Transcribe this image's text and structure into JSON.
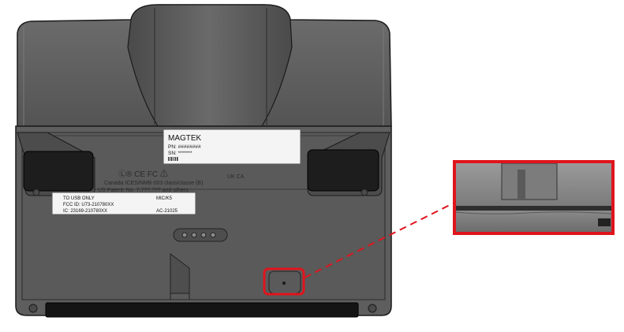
{
  "product_label": {
    "brand": "MAGTEK",
    "pn": "PN: ########",
    "sn": "SN: *******"
  },
  "regulatory": {
    "marks": "Ⓛ® CE FC ⚠",
    "canada": "Canada ICES/NMB-003 class/classe (B)",
    "patent": "US Patent: No. 7,7??,??? and others",
    "ukca": "UK CA"
  },
  "fcc_label": {
    "line1": "TO USB ONLY",
    "line1_right": "MIC/K5",
    "line2": "FCC ID: U73-210780XX",
    "line3": "IC: 23169-210780XX",
    "line3_right": "AC-21025"
  },
  "colors": {
    "housing": "#5b5b5b",
    "housing_dark": "#3a3a3a",
    "highlight": "#e0141c"
  }
}
